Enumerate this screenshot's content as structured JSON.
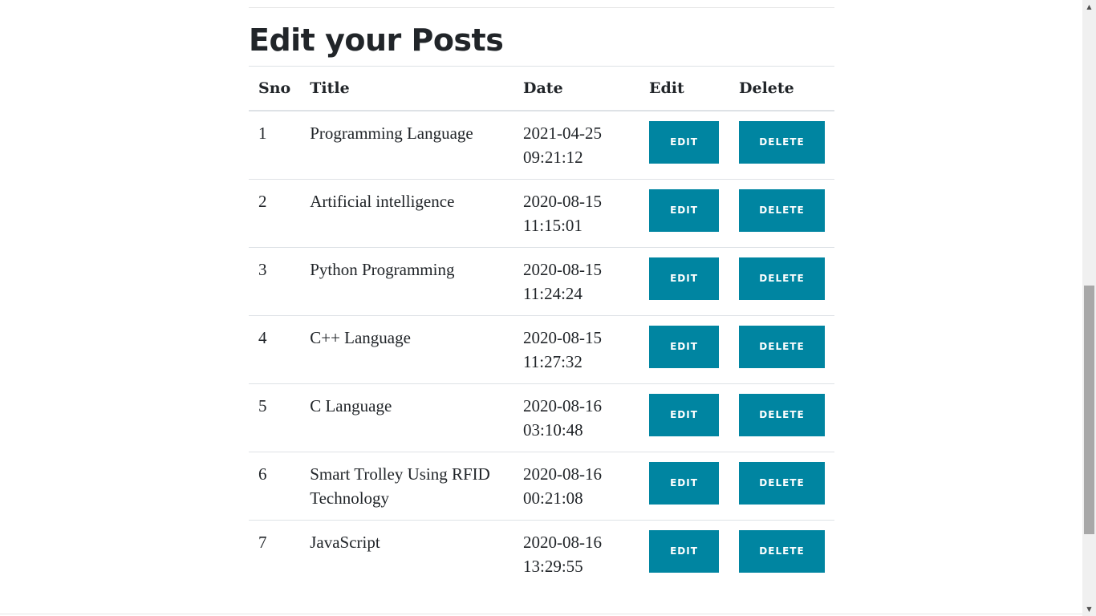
{
  "page": {
    "title": "Edit your Posts"
  },
  "table": {
    "headers": {
      "sno": "Sno",
      "title": "Title",
      "date": "Date",
      "edit": "Edit",
      "delete": "Delete"
    },
    "rows": [
      {
        "sno": "1",
        "title": "Programming Language",
        "date": "2021-04-25 09:21:12",
        "edit_label": "EDIT",
        "delete_label": "DELETE"
      },
      {
        "sno": "2",
        "title": "Artificial intelligence",
        "date": "2020-08-15 11:15:01",
        "edit_label": "EDIT",
        "delete_label": "DELETE"
      },
      {
        "sno": "3",
        "title": "Python Programming",
        "date": "2020-08-15 11:24:24",
        "edit_label": "EDIT",
        "delete_label": "DELETE"
      },
      {
        "sno": "4",
        "title": "C++ Language",
        "date": "2020-08-15 11:27:32",
        "edit_label": "EDIT",
        "delete_label": "DELETE"
      },
      {
        "sno": "5",
        "title": "C Language",
        "date": "2020-08-16 03:10:48",
        "edit_label": "EDIT",
        "delete_label": "DELETE"
      },
      {
        "sno": "6",
        "title": "Smart Trolley Using RFID Technology",
        "date": "2020-08-16 00:21:08",
        "edit_label": "EDIT",
        "delete_label": "DELETE"
      },
      {
        "sno": "7",
        "title": "JavaScript",
        "date": "2020-08-16 13:29:55",
        "edit_label": "EDIT",
        "delete_label": "DELETE"
      }
    ]
  },
  "theme": {
    "button_color": "#0085a1",
    "text_color": "#212529"
  },
  "scrollbar": {
    "up_icon": "▲",
    "down_icon": "▼",
    "scroll_position_fraction": 0.6
  }
}
